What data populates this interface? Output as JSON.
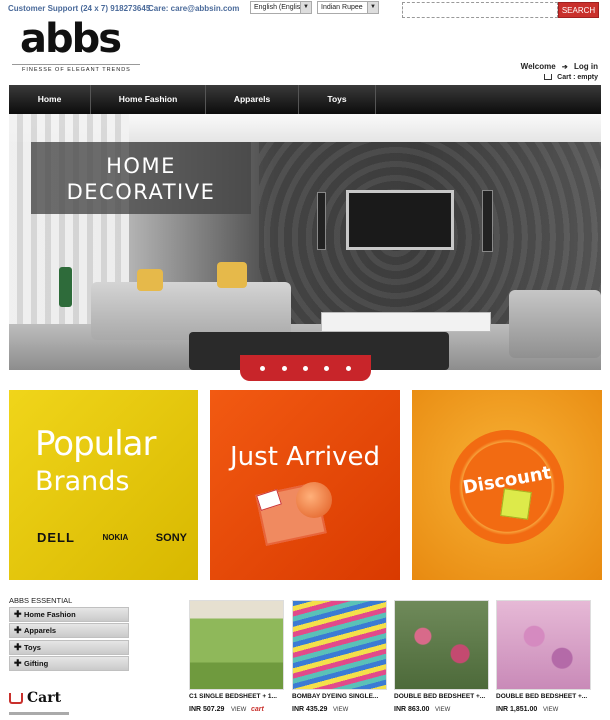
{
  "topbar": {
    "support": "Customer Support (24 x 7) 918273645",
    "care": "Care: care@abbsin.com",
    "language": "English (English)",
    "currency": "Indian Rupee",
    "search_placeholder": "",
    "search_button": "SEARCH"
  },
  "logo": {
    "word": "abbs",
    "tagline": "FINESSE OF ELEGANT TRENDS"
  },
  "account": {
    "welcome": "Welcome",
    "login": "Log in",
    "cart_label": "Cart :",
    "cart_value": "empty"
  },
  "nav": {
    "items": [
      "Home",
      "Home Fashion",
      "Apparels",
      "Toys"
    ]
  },
  "hero": {
    "caption_line1": "HOME",
    "caption_line2": "DECORATIVE",
    "slide_count": 5
  },
  "tiles": {
    "popular_line1": "Popular",
    "popular_line2": "Brands",
    "brands": [
      "DELL",
      "NOKIA",
      "SONY"
    ],
    "just_arrived": "Just Arrived",
    "discount": "Discount"
  },
  "sidebar": {
    "title": "ABBS ESSENTIAL",
    "items": [
      "Home Fashion",
      "Apparels",
      "Toys",
      "Gifting"
    ]
  },
  "cart_box": {
    "title": "Cart"
  },
  "products": [
    {
      "name": "C1 SINGLE BEDSHEET + 1...",
      "price": "INR 507.29",
      "view": "VIEW",
      "cart": "cart"
    },
    {
      "name": "BOMBAY DYEING SINGLE...",
      "price": "INR 435.29",
      "view": "VIEW"
    },
    {
      "name": "DOUBLE BED BEDSHEET +...",
      "price": "INR 863.00",
      "view": "VIEW"
    },
    {
      "name": "DOUBLE BED BEDSHEET +...",
      "price": "INR 1,851.00",
      "view": "VIEW"
    }
  ],
  "colors": {
    "accent_red": "#c9302c",
    "nav_bg": "#1a1a1a",
    "link_blue": "#4a6a9a"
  }
}
